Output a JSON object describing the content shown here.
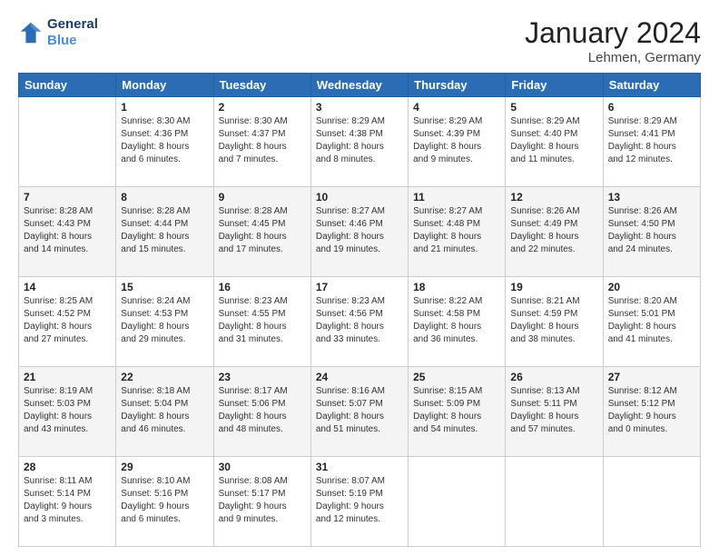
{
  "logo": {
    "line1": "General",
    "line2": "Blue"
  },
  "title": "January 2024",
  "subtitle": "Lehmen, Germany",
  "days_header": [
    "Sunday",
    "Monday",
    "Tuesday",
    "Wednesday",
    "Thursday",
    "Friday",
    "Saturday"
  ],
  "weeks": [
    [
      {
        "num": "",
        "info": ""
      },
      {
        "num": "1",
        "info": "Sunrise: 8:30 AM\nSunset: 4:36 PM\nDaylight: 8 hours\nand 6 minutes."
      },
      {
        "num": "2",
        "info": "Sunrise: 8:30 AM\nSunset: 4:37 PM\nDaylight: 8 hours\nand 7 minutes."
      },
      {
        "num": "3",
        "info": "Sunrise: 8:29 AM\nSunset: 4:38 PM\nDaylight: 8 hours\nand 8 minutes."
      },
      {
        "num": "4",
        "info": "Sunrise: 8:29 AM\nSunset: 4:39 PM\nDaylight: 8 hours\nand 9 minutes."
      },
      {
        "num": "5",
        "info": "Sunrise: 8:29 AM\nSunset: 4:40 PM\nDaylight: 8 hours\nand 11 minutes."
      },
      {
        "num": "6",
        "info": "Sunrise: 8:29 AM\nSunset: 4:41 PM\nDaylight: 8 hours\nand 12 minutes."
      }
    ],
    [
      {
        "num": "7",
        "info": "Sunrise: 8:28 AM\nSunset: 4:43 PM\nDaylight: 8 hours\nand 14 minutes."
      },
      {
        "num": "8",
        "info": "Sunrise: 8:28 AM\nSunset: 4:44 PM\nDaylight: 8 hours\nand 15 minutes."
      },
      {
        "num": "9",
        "info": "Sunrise: 8:28 AM\nSunset: 4:45 PM\nDaylight: 8 hours\nand 17 minutes."
      },
      {
        "num": "10",
        "info": "Sunrise: 8:27 AM\nSunset: 4:46 PM\nDaylight: 8 hours\nand 19 minutes."
      },
      {
        "num": "11",
        "info": "Sunrise: 8:27 AM\nSunset: 4:48 PM\nDaylight: 8 hours\nand 21 minutes."
      },
      {
        "num": "12",
        "info": "Sunrise: 8:26 AM\nSunset: 4:49 PM\nDaylight: 8 hours\nand 22 minutes."
      },
      {
        "num": "13",
        "info": "Sunrise: 8:26 AM\nSunset: 4:50 PM\nDaylight: 8 hours\nand 24 minutes."
      }
    ],
    [
      {
        "num": "14",
        "info": "Sunrise: 8:25 AM\nSunset: 4:52 PM\nDaylight: 8 hours\nand 27 minutes."
      },
      {
        "num": "15",
        "info": "Sunrise: 8:24 AM\nSunset: 4:53 PM\nDaylight: 8 hours\nand 29 minutes."
      },
      {
        "num": "16",
        "info": "Sunrise: 8:23 AM\nSunset: 4:55 PM\nDaylight: 8 hours\nand 31 minutes."
      },
      {
        "num": "17",
        "info": "Sunrise: 8:23 AM\nSunset: 4:56 PM\nDaylight: 8 hours\nand 33 minutes."
      },
      {
        "num": "18",
        "info": "Sunrise: 8:22 AM\nSunset: 4:58 PM\nDaylight: 8 hours\nand 36 minutes."
      },
      {
        "num": "19",
        "info": "Sunrise: 8:21 AM\nSunset: 4:59 PM\nDaylight: 8 hours\nand 38 minutes."
      },
      {
        "num": "20",
        "info": "Sunrise: 8:20 AM\nSunset: 5:01 PM\nDaylight: 8 hours\nand 41 minutes."
      }
    ],
    [
      {
        "num": "21",
        "info": "Sunrise: 8:19 AM\nSunset: 5:03 PM\nDaylight: 8 hours\nand 43 minutes."
      },
      {
        "num": "22",
        "info": "Sunrise: 8:18 AM\nSunset: 5:04 PM\nDaylight: 8 hours\nand 46 minutes."
      },
      {
        "num": "23",
        "info": "Sunrise: 8:17 AM\nSunset: 5:06 PM\nDaylight: 8 hours\nand 48 minutes."
      },
      {
        "num": "24",
        "info": "Sunrise: 8:16 AM\nSunset: 5:07 PM\nDaylight: 8 hours\nand 51 minutes."
      },
      {
        "num": "25",
        "info": "Sunrise: 8:15 AM\nSunset: 5:09 PM\nDaylight: 8 hours\nand 54 minutes."
      },
      {
        "num": "26",
        "info": "Sunrise: 8:13 AM\nSunset: 5:11 PM\nDaylight: 8 hours\nand 57 minutes."
      },
      {
        "num": "27",
        "info": "Sunrise: 8:12 AM\nSunset: 5:12 PM\nDaylight: 9 hours\nand 0 minutes."
      }
    ],
    [
      {
        "num": "28",
        "info": "Sunrise: 8:11 AM\nSunset: 5:14 PM\nDaylight: 9 hours\nand 3 minutes."
      },
      {
        "num": "29",
        "info": "Sunrise: 8:10 AM\nSunset: 5:16 PM\nDaylight: 9 hours\nand 6 minutes."
      },
      {
        "num": "30",
        "info": "Sunrise: 8:08 AM\nSunset: 5:17 PM\nDaylight: 9 hours\nand 9 minutes."
      },
      {
        "num": "31",
        "info": "Sunrise: 8:07 AM\nSunset: 5:19 PM\nDaylight: 9 hours\nand 12 minutes."
      },
      {
        "num": "",
        "info": ""
      },
      {
        "num": "",
        "info": ""
      },
      {
        "num": "",
        "info": ""
      }
    ]
  ]
}
